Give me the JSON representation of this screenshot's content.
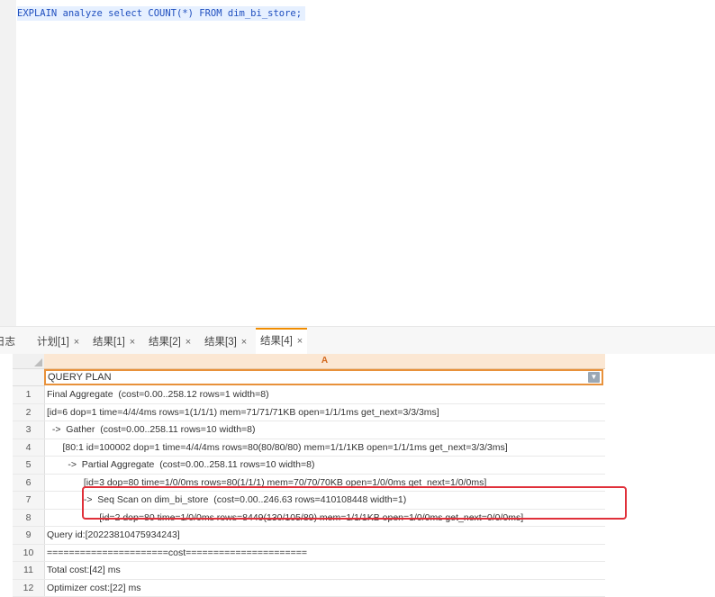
{
  "editor": {
    "sql": "EXPLAIN analyze select COUNT(*) FROM dim_bi_store;"
  },
  "tabs": [
    {
      "label": "日志",
      "closable": false
    },
    {
      "label": "计划[1]",
      "closable": true
    },
    {
      "label": "结果[1]",
      "closable": true
    },
    {
      "label": "结果[2]",
      "closable": true
    },
    {
      "label": "结果[3]",
      "closable": true
    },
    {
      "label": "结果[4]",
      "closable": true,
      "active": true
    }
  ],
  "tab_close_glyph": "×",
  "grid": {
    "column_letter": "A",
    "column_name": "QUERY PLAN",
    "dropdown_glyph": "▼",
    "rows": [
      {
        "num": "1",
        "text": "Final Aggregate  (cost=0.00..258.12 rows=1 width=8)"
      },
      {
        "num": "2",
        "text": "[id=6 dop=1 time=4/4/4ms rows=1(1/1/1) mem=71/71/71KB open=1/1/1ms get_next=3/3/3ms]"
      },
      {
        "num": "3",
        "text": "  ->  Gather  (cost=0.00..258.11 rows=10 width=8)"
      },
      {
        "num": "4",
        "text": "      [80:1 id=100002 dop=1 time=4/4/4ms rows=80(80/80/80) mem=1/1/1KB open=1/1/1ms get_next=3/3/3ms]"
      },
      {
        "num": "5",
        "text": "        ->  Partial Aggregate  (cost=0.00..258.11 rows=10 width=8)"
      },
      {
        "num": "6",
        "text": "              [id=3 dop=80 time=1/0/0ms rows=80(1/1/1) mem=70/70/70KB open=1/0/0ms get_next=1/0/0ms]"
      },
      {
        "num": "7",
        "text": "              ->  Seq Scan on dim_bi_store  (cost=0.00..246.63 rows=410108448 width=1)"
      },
      {
        "num": "8",
        "text": "                    [id=2 dop=80 time=1/0/0ms rows=8449(130/105/89) mem=1/1/1KB open=1/0/0ms get_next=0/0/0ms]"
      },
      {
        "num": "9",
        "text": "Query id:[20223810475934243]"
      },
      {
        "num": "10",
        "text": "======================cost======================"
      },
      {
        "num": "11",
        "text": "Total cost:[42] ms"
      },
      {
        "num": "12",
        "text": "Optimizer cost:[22] ms"
      }
    ]
  },
  "colors": {
    "accent": "#f08c00",
    "highlight_box": "#e0303a",
    "sql_text": "#1f4fbf"
  }
}
